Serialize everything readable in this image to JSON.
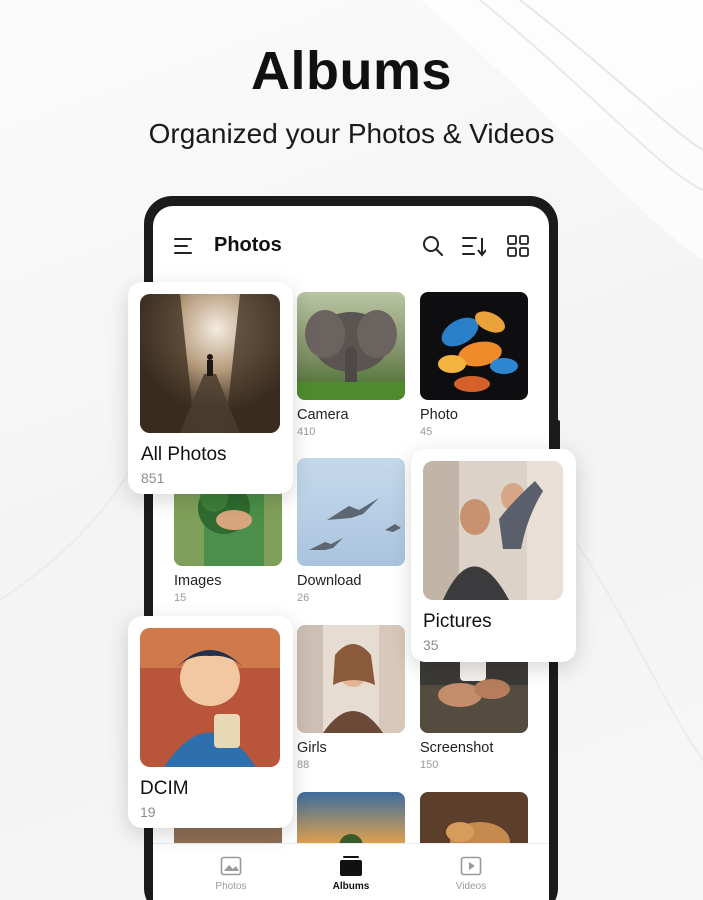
{
  "promo": {
    "headline": "Albums",
    "subheadline": "Organized your Photos & Videos"
  },
  "app": {
    "title": "Photos",
    "icons": [
      "menu-icon",
      "search-icon",
      "sort-icon",
      "grid-view-icon"
    ]
  },
  "albums": [
    {
      "label": "Camera",
      "count": "410"
    },
    {
      "label": "Photo",
      "count": "45"
    },
    {
      "label": "Images",
      "count": "15"
    },
    {
      "label": "Download",
      "count": "26"
    },
    {
      "label": "Girls",
      "count": "88"
    },
    {
      "label": "Screenshot",
      "count": "150"
    }
  ],
  "featured": [
    {
      "label": "All Photos",
      "count": "851"
    },
    {
      "label": "Pictures",
      "count": "35"
    },
    {
      "label": "DCIM",
      "count": "19"
    }
  ],
  "bottom_nav": [
    {
      "label": "Photos",
      "icon": "image-icon",
      "active": false
    },
    {
      "label": "Albums",
      "icon": "album-icon",
      "active": true
    },
    {
      "label": "Videos",
      "icon": "video-icon",
      "active": false
    }
  ],
  "colors": {
    "accent": "#111111",
    "muted_text": "#9a9a9a",
    "phone_frame": "#1b1b1b"
  }
}
